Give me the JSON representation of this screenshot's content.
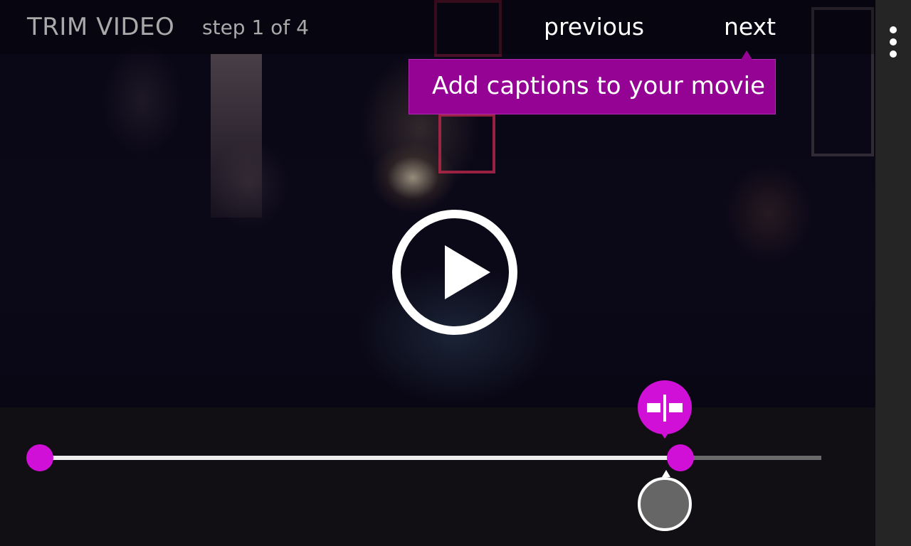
{
  "header": {
    "title": "TRIM VIDEO",
    "step": "step 1 of 4",
    "previous_label": "previous",
    "next_label": "next"
  },
  "tooltip": {
    "text": "Add captions to your movie"
  },
  "player": {
    "play_icon": "play-icon"
  },
  "trim": {
    "start_fraction": 0.0,
    "end_fraction": 0.82,
    "playhead_fraction": 0.8,
    "split_icon": "split-icon"
  },
  "app_bar": {
    "more_icon": "more-ellipsis-icon"
  },
  "colors": {
    "accent": "#d010d6",
    "tooltip_bg": "#940394",
    "app_bar_bg": "#252525"
  }
}
